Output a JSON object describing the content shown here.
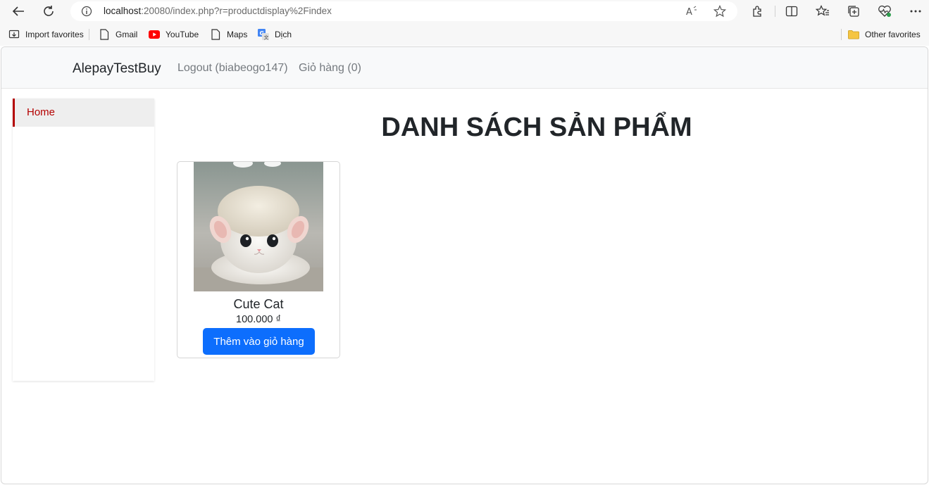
{
  "browser": {
    "url_host": "localhost",
    "url_rest": ":20080/index.php?r=productdisplay%2Findex",
    "favorites": [
      {
        "label": "Import favorites",
        "icon": "import-icon"
      },
      {
        "label": "Gmail",
        "icon": "page-icon"
      },
      {
        "label": "YouTube",
        "icon": "youtube-icon"
      },
      {
        "label": "Maps",
        "icon": "page-icon"
      },
      {
        "label": "Dịch",
        "icon": "translate-icon"
      }
    ],
    "other_favorites": "Other favorites"
  },
  "site": {
    "brand": "AlepayTestBuy",
    "logout": "Logout (biabeogo147)",
    "cart": "Giỏ hàng (0)"
  },
  "sidebar": {
    "items": [
      {
        "label": "Home",
        "active": true
      }
    ]
  },
  "main": {
    "title": "DANH SÁCH SẢN PHẨM",
    "products": [
      {
        "name": "Cute Cat",
        "price": "100.000 ₫",
        "button": "Thêm vào giỏ hàng",
        "image_icon": "cat-photo"
      }
    ]
  },
  "colors": {
    "accent": "#b40000",
    "primary_button": "#0d6efd"
  }
}
